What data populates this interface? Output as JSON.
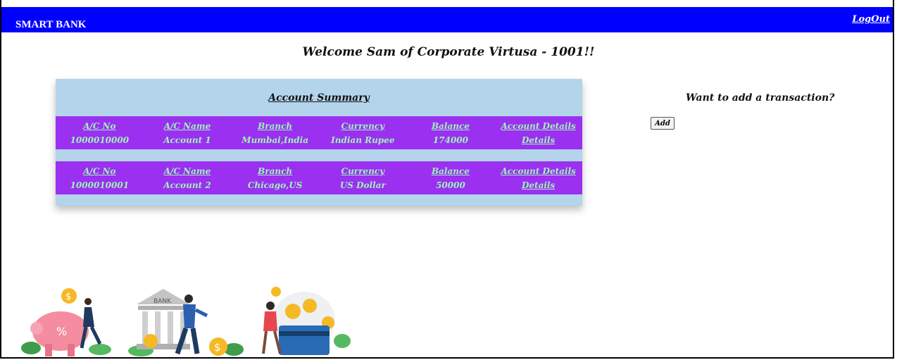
{
  "header": {
    "brand": "SMART BANK",
    "logout": "LogOut"
  },
  "welcome": "Welcome Sam of Corporate Virtusa - 1001!!",
  "summary": {
    "title": "Account Summary",
    "headers": [
      "A/C No",
      "A/C Name",
      "Branch",
      "Currency",
      "Balance",
      "Account Details"
    ],
    "accounts": [
      {
        "no": "1000010000",
        "name": "Account 1",
        "branch": "Mumbai,India",
        "currency": "Indian Rupee",
        "balance": "174000",
        "details": "Details"
      },
      {
        "no": "1000010001",
        "name": "Account 2",
        "branch": "Chicago,US",
        "currency": "US Dollar",
        "balance": "50000",
        "details": "Details"
      }
    ]
  },
  "transaction": {
    "question": "Want to add a transaction?",
    "add_label": "Add"
  },
  "illustrations": {
    "bank_sign": "BANK"
  },
  "colors": {
    "navbar": "#0000ff",
    "row": "#9b30f0",
    "row_text": "#9cf5b8",
    "panel": "#b4d4ec"
  }
}
